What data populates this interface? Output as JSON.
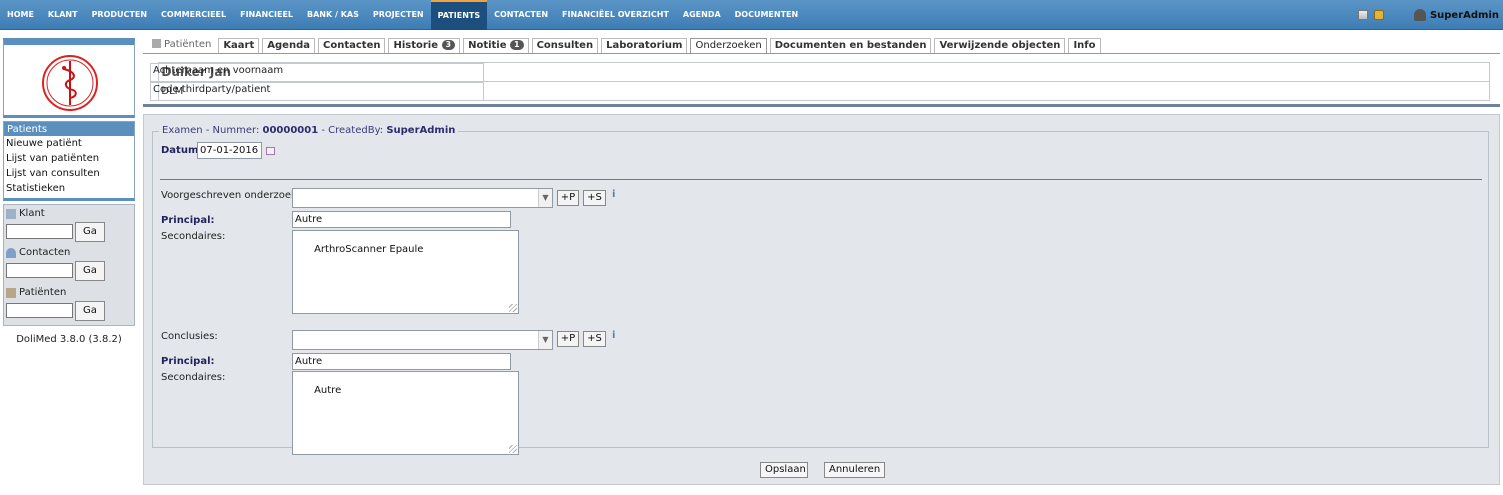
{
  "topmenu": {
    "items": [
      "HOME",
      "KLANT",
      "PRODUCTEN",
      "COMMERCIEEL",
      "FINANCIEEL",
      "BANK / KAS",
      "PROJECTEN",
      "PATIENTS",
      "CONTACTEN",
      "FINANCIËEL OVERZICHT",
      "AGENDA",
      "DOCUMENTEN"
    ],
    "active": "PATIENTS",
    "user": "SuperAdmin"
  },
  "sidebar": {
    "menu_title": "Patients",
    "links": [
      "Nieuwe patiënt",
      "Lijst van patiënten",
      "Lijst van consulten",
      "Statistieken"
    ],
    "search": [
      {
        "label": "Klant",
        "button": "Ga"
      },
      {
        "label": "Contacten",
        "button": "Ga"
      },
      {
        "label": "Patiënten",
        "button": "Ga"
      }
    ],
    "version": "DoliMed 3.8.0 (3.8.2)"
  },
  "tabs": {
    "first": "Patiënten",
    "items": [
      {
        "label": "Kaart",
        "badge": ""
      },
      {
        "label": "Agenda",
        "badge": ""
      },
      {
        "label": "Contacten",
        "badge": ""
      },
      {
        "label": "Historie",
        "badge": "3"
      },
      {
        "label": "Notitie",
        "badge": "1"
      },
      {
        "label": "Consulten",
        "badge": ""
      },
      {
        "label": "Laboratorium",
        "badge": ""
      },
      {
        "label": "Onderzoeken",
        "badge": ""
      },
      {
        "label": "Documenten en bestanden",
        "badge": ""
      },
      {
        "label": "Verwijzende objecten",
        "badge": ""
      },
      {
        "label": "Info",
        "badge": ""
      }
    ],
    "active": "Onderzoeken"
  },
  "patient": {
    "name_label": "Achternaam en voornaam",
    "name_value": "Duiker Jan",
    "code_label": "Code thirdparty/patient",
    "code_value": "DLM"
  },
  "exam": {
    "legend_prefix": "Examen - Nummer: ",
    "number": "00000001",
    "created_prefix": " - CreatedBy: ",
    "created_by": "SuperAdmin",
    "date_label": "Datum:",
    "date_value": "07-01-2016",
    "prescribed_label": "Voorgeschreven onderzoek:",
    "prescribed_select": "",
    "btn_p": "+P",
    "btn_s": "+S",
    "principal_label": "Principal:",
    "principal1": "Autre",
    "secondaires_label": "Secondaires:",
    "secondaires1": "ArthroScanner Epaule",
    "conclusions_label": "Conclusies:",
    "conclusions_select": "",
    "principal2": "Autre",
    "secondaires2": "Autre"
  },
  "footer": {
    "save": "Opslaan",
    "cancel": "Annuleren"
  },
  "colors": {
    "topbar": "#4a88bf",
    "active_menu": "#1d4f7e",
    "panel_bg": "#e3e7eb",
    "label_dark": "#23235e"
  }
}
